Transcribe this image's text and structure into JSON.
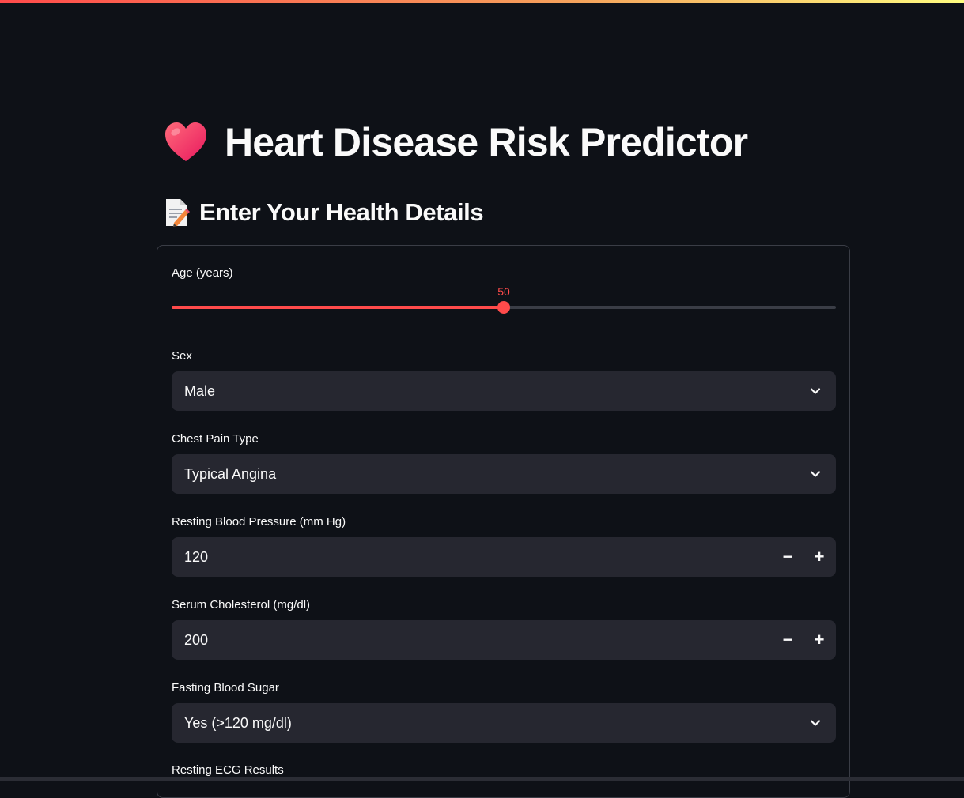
{
  "app": {
    "title": "Heart Disease Risk Predictor",
    "heart_icon": "heart-icon",
    "accent_color": "#ff4b4b"
  },
  "section": {
    "title": "Enter Your Health Details",
    "icon": "memo-pencil-icon"
  },
  "form": {
    "age": {
      "label": "Age (years)",
      "value": "50",
      "fraction": 0.5
    },
    "sex": {
      "label": "Sex",
      "value": "Male"
    },
    "chest_pain": {
      "label": "Chest Pain Type",
      "value": "Typical Angina"
    },
    "resting_bp": {
      "label": "Resting Blood Pressure (mm Hg)",
      "value": "120"
    },
    "cholesterol": {
      "label": "Serum Cholesterol (mg/dl)",
      "value": "200"
    },
    "fasting_sugar": {
      "label": "Fasting Blood Sugar",
      "value": "Yes (>120 mg/dl)"
    },
    "resting_ecg": {
      "label": "Resting ECG Results"
    }
  },
  "stepper": {
    "minus": "−",
    "plus": "+"
  }
}
